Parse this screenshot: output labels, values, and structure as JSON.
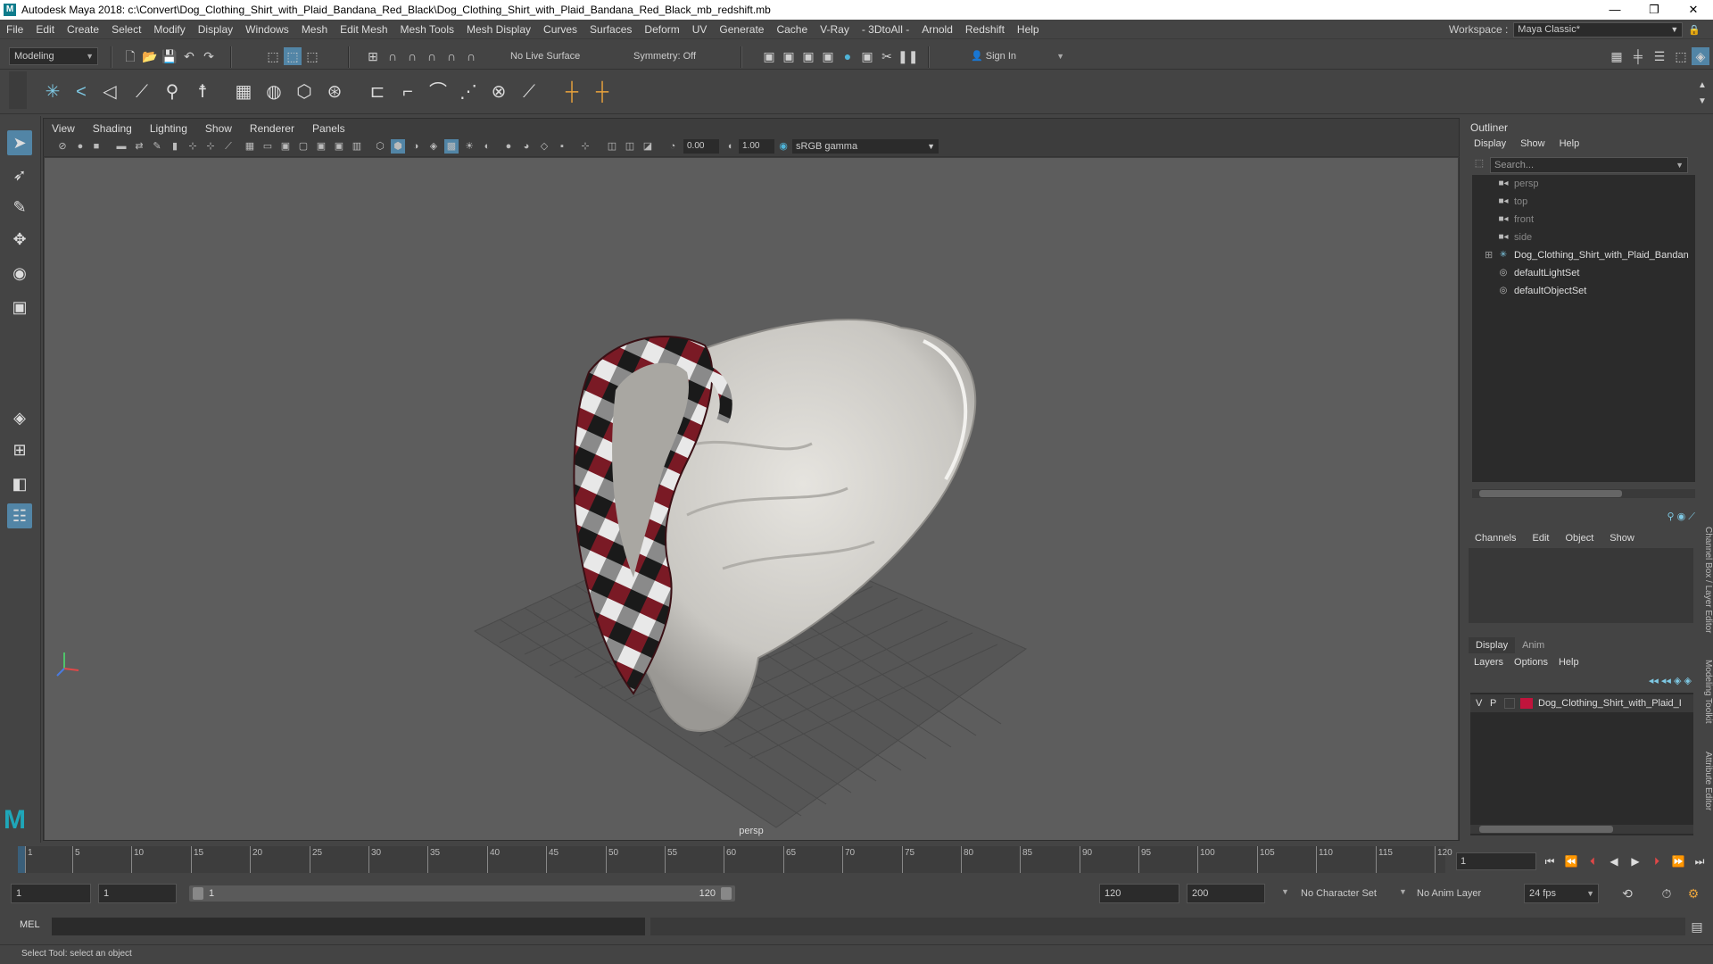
{
  "titlebar": {
    "title": "Autodesk Maya 2018: c:\\Convert\\Dog_Clothing_Shirt_with_Plaid_Bandana_Red_Black\\Dog_Clothing_Shirt_with_Plaid_Bandana_Red_Black_mb_redshift.mb",
    "logo": "M",
    "minimize": "—",
    "maximize": "❐",
    "close": "✕"
  },
  "menubar": {
    "items": [
      "File",
      "Edit",
      "Create",
      "Select",
      "Modify",
      "Display",
      "Windows",
      "Mesh",
      "Edit Mesh",
      "Mesh Tools",
      "Mesh Display",
      "Curves",
      "Surfaces",
      "Deform",
      "UV",
      "Generate",
      "Cache",
      "V-Ray",
      "- 3DtoAll -",
      "Arnold",
      "Redshift",
      "Help"
    ],
    "workspace_label": "Workspace :",
    "workspace_value": "Maya Classic*"
  },
  "statusline": {
    "mode": "Modeling",
    "live_surface": "No Live Surface",
    "symmetry": "Symmetry: Off",
    "sign_in": "Sign In"
  },
  "viewport": {
    "menu": [
      "View",
      "Shading",
      "Lighting",
      "Show",
      "Renderer",
      "Panels"
    ],
    "exposure": "0.00",
    "gamma": "1.00",
    "color_space": "sRGB gamma",
    "camera_label": "persp"
  },
  "outliner": {
    "title": "Outliner",
    "menu": [
      "Display",
      "Show",
      "Help"
    ],
    "search_placeholder": "Search...",
    "items": [
      {
        "label": "persp",
        "icon": "camera-icon",
        "dim": true
      },
      {
        "label": "top",
        "icon": "camera-icon",
        "dim": true
      },
      {
        "label": "front",
        "icon": "camera-icon",
        "dim": true
      },
      {
        "label": "side",
        "icon": "camera-icon",
        "dim": true
      },
      {
        "label": "Dog_Clothing_Shirt_with_Plaid_Bandan",
        "icon": "transform-icon",
        "dim": false
      },
      {
        "label": "defaultLightSet",
        "icon": "set-icon",
        "dim": false
      },
      {
        "label": "defaultObjectSet",
        "icon": "set-icon",
        "dim": false
      }
    ]
  },
  "channelbox": {
    "menu": [
      "Channels",
      "Edit",
      "Object",
      "Show"
    ]
  },
  "layers": {
    "tabs": [
      "Display",
      "Anim"
    ],
    "menu": [
      "Layers",
      "Options",
      "Help"
    ],
    "row": {
      "v": "V",
      "p": "P",
      "name": "Dog_Clothing_Shirt_with_Plaid_I",
      "color": "#c0143c"
    }
  },
  "sidetabs": [
    "Channel Box / Layer Editor",
    "Modeling Toolkit",
    "Attribute Editor"
  ],
  "timeline": {
    "ticks": [
      "1",
      "5",
      "10",
      "15",
      "20",
      "25",
      "30",
      "35",
      "40",
      "45",
      "50",
      "55",
      "60",
      "65",
      "70",
      "75",
      "80",
      "85",
      "90",
      "95",
      "100",
      "105",
      "110",
      "115",
      "120"
    ],
    "current_frame": "1"
  },
  "range": {
    "start": "1",
    "playback_start": "1",
    "slider_start": "1",
    "slider_end": "120",
    "playback_end": "120",
    "end": "200",
    "character_set": "No Character Set",
    "anim_layer": "No Anim Layer",
    "fps": "24 fps"
  },
  "command": {
    "label": "MEL"
  },
  "help": {
    "text": "Select Tool: select an object"
  }
}
